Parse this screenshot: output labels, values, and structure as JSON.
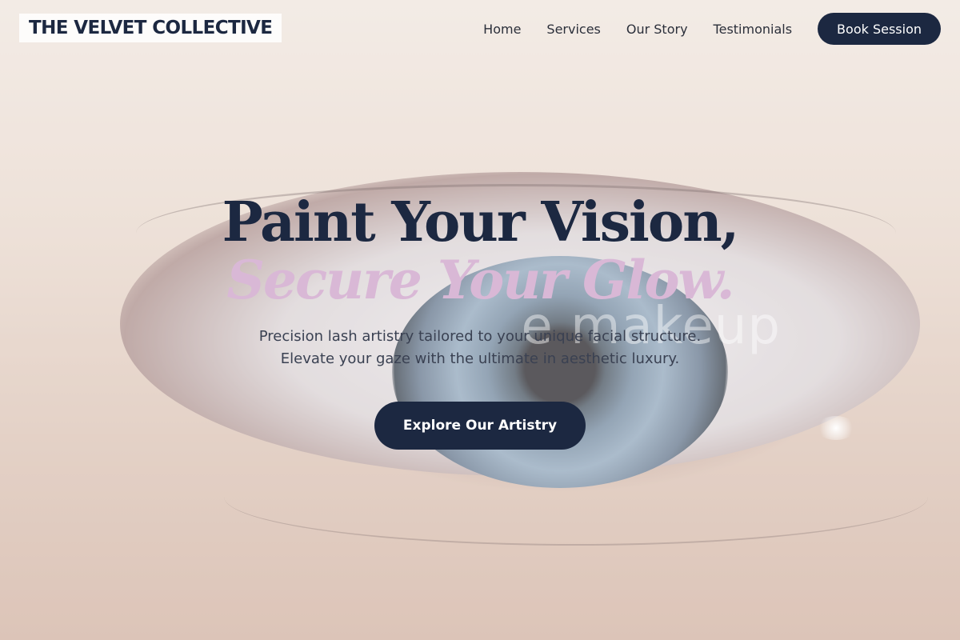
{
  "header": {
    "logo": "THE VELVET COLLECTIVE",
    "nav": [
      {
        "label": "Home"
      },
      {
        "label": "Services"
      },
      {
        "label": "Our Story"
      },
      {
        "label": "Testimonials"
      }
    ],
    "book_button": "Book Session"
  },
  "hero": {
    "headline": "Paint Your Vision,",
    "subheadline": "Secure Your Glow.",
    "watermark": "e makeup",
    "tagline_line1": "Precision lash artistry tailored to your unique facial structure.",
    "tagline_line2": "Elevate your gaze with the ultimate in aesthetic luxury.",
    "cta": "Explore Our Artistry"
  },
  "colors": {
    "navy": "#1c2841",
    "lilac_accent": "#d9b8d6"
  }
}
